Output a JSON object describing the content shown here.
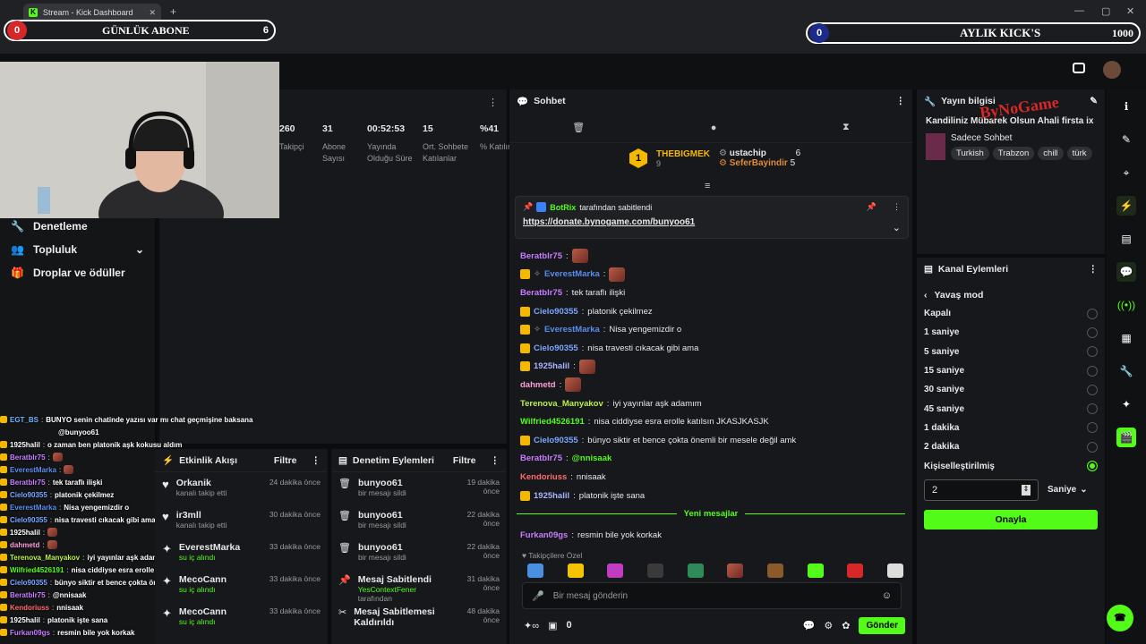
{
  "browser": {
    "tab_title": "Stream - Kick Dashboard",
    "url": "dashboard.kick.com/stream"
  },
  "overlay": {
    "daily_left_value": "0",
    "daily_label": "GÜNLÜK ABONE",
    "daily_right_value": "6",
    "monthly_left_value": "0",
    "monthly_label": "AYLIK KICK'S",
    "monthly_right_value": "1000"
  },
  "nav": {
    "items": [
      {
        "label": "Denetleme",
        "icon": "wrench-icon"
      },
      {
        "label": "Topluluk",
        "icon": "community-icon"
      },
      {
        "label": "Droplar ve ödüller",
        "icon": "gift-icon"
      }
    ]
  },
  "stats": [
    {
      "value": "260",
      "label": "Takipçi"
    },
    {
      "value": "31",
      "label": "Abone Sayısı"
    },
    {
      "value": "00:52:53",
      "label": "Yayında Olduğu Süre"
    },
    {
      "value": "15",
      "label": "Ort. Sohbete Katılanlar"
    },
    {
      "value": "%41",
      "label": "% Katılım"
    }
  ],
  "activity": {
    "title": "Etkinlik Akışı",
    "filter": "Filtre",
    "items": [
      {
        "name": "Orkanik",
        "sub": "kanalı takip etti",
        "time": "24 dakika önce",
        "icon": "heart-icon"
      },
      {
        "name": "ir3mll",
        "sub": "kanalı takip etti",
        "time": "30 dakika önce",
        "icon": "heart-icon"
      },
      {
        "name": "EverestMarka",
        "sub": "su iç alındı",
        "time": "33 dakika önce",
        "icon": "points-icon"
      },
      {
        "name": "MecoCann",
        "sub": "su iç alındı",
        "time": "33 dakika önce",
        "icon": "points-icon"
      },
      {
        "name": "MecoCann",
        "sub": "su iç alındı",
        "time": "33 dakika önce",
        "icon": "points-icon"
      }
    ]
  },
  "moderation": {
    "title": "Denetim Eylemleri",
    "filter": "Filtre",
    "items": [
      {
        "name": "bunyoo61",
        "sub": "bir mesajı sildi",
        "time": "19 dakika önce"
      },
      {
        "name": "bunyoo61",
        "sub": "bir mesajı sildi",
        "time": "22 dakika önce"
      },
      {
        "name": "bunyoo61",
        "sub": "bir mesajı sildi",
        "time": "22 dakika önce"
      },
      {
        "name": "Mesaj Sabitlendi",
        "sub": "YesContextFener",
        "sub2": "tarafından",
        "time": "31 dakika önce"
      },
      {
        "name": "Mesaj Sabitlemesi Kaldırıldı",
        "sub": "",
        "time": "48 dakika önce"
      }
    ]
  },
  "chat": {
    "title": "Sohbet",
    "leaderboard": {
      "first_name": "THEBIGMEK",
      "first_count": "9",
      "first_rank": "1",
      "second_name": "ustachip",
      "second_count": "6",
      "third_name": "SeferBayindir",
      "third_count": "5"
    },
    "pinned": {
      "by_user": "BotRix",
      "by_text": "tarafından sabitlendi",
      "link": "https://donate.bynogame.com/bunyoo61"
    },
    "messages": [
      {
        "user": "Beratblr75",
        "color": "#c77dff",
        "text": "",
        "emote": true
      },
      {
        "user": "EverestMarka",
        "color": "#5b8def",
        "text": "",
        "emote": true
      },
      {
        "user": "Beratblr75",
        "color": "#c77dff",
        "text": "tek taraflı ilişki"
      },
      {
        "user": "Cielo90355",
        "color": "#7aa7ff",
        "text": "platonik çekilmez"
      },
      {
        "user": "EverestMarka",
        "color": "#5b8def",
        "text": "Nisa yengemizdir o"
      },
      {
        "user": "Cielo90355",
        "color": "#7aa7ff",
        "text": "nisa travesti cıkacak gibi ama"
      },
      {
        "user": "1925halil",
        "color": "#a9b4ff",
        "text": "",
        "emote": true
      },
      {
        "user": "dahmetd",
        "color": "#ff9ed8",
        "text": "",
        "emote": true
      },
      {
        "user": "Terenova_Manyakov",
        "color": "#b8f04a",
        "text": "iyi yayınlar aşk adamım"
      },
      {
        "user": "Wilfried4526191",
        "color": "#53fc18",
        "text": "nisa ciddiyse esra erolle katılsın JKASJKASJK"
      },
      {
        "user": "Cielo90355",
        "color": "#7aa7ff",
        "text": "bünyo siktir et bence çokta önemli bir mesele değil amk"
      },
      {
        "user": "Beratblr75",
        "color": "#c77dff",
        "text": "@nnisaak",
        "bold_text": true
      },
      {
        "user": "Kendoriuss",
        "color": "#ff6b6b",
        "text": "nnisaak"
      },
      {
        "user": "1925halil",
        "color": "#a9b4ff",
        "text": "platonik işte sana"
      }
    ],
    "new_messages": "Yeni mesajlar",
    "last_message": {
      "user": "Furkan09gs",
      "color": "#c77dff",
      "text": "resmin bile yok korkak"
    },
    "followers_only": "Takipçilere Özel",
    "input_placeholder": "Bir mesaj gönderin",
    "points": "0",
    "send": "Gönder"
  },
  "stream_info": {
    "title": "Yayın bilgisi",
    "stream_title": "Kandiliniz Mübarek Olsun Ahali firsta ix",
    "category": "Sadece Sohbet",
    "tags": [
      "Turkish",
      "Trabzon",
      "chill",
      "türk"
    ]
  },
  "channel_actions": {
    "title": "Kanal Eylemleri",
    "back_label": "Yavaş mod",
    "options": [
      {
        "label": "Kapalı",
        "selected": false
      },
      {
        "label": "1 saniye",
        "selected": false
      },
      {
        "label": "5 saniye",
        "selected": false
      },
      {
        "label": "15 saniye",
        "selected": false
      },
      {
        "label": "30 saniye",
        "selected": false
      },
      {
        "label": "45 saniye",
        "selected": false
      },
      {
        "label": "1 dakika",
        "selected": false
      },
      {
        "label": "2 dakika",
        "selected": false
      },
      {
        "label": "Kişiselleştirilmiş",
        "selected": true
      }
    ],
    "custom_value": "2",
    "unit": "Saniye",
    "confirm": "Onayla"
  },
  "overlay_chat": [
    {
      "user": "EGT_BS",
      "color": "#6fb3ff",
      "text": "BUNYO senin chatinde yazısı var mı chat geçmişine baksana"
    },
    {
      "user": "",
      "color": "#fff",
      "text": "@bunyoo61"
    },
    {
      "user": "1925halil",
      "color": "#fff",
      "text": "o zaman ben platonik aşk kokusu aldım"
    },
    {
      "user": "Beratblr75",
      "color": "#c77dff",
      "text": ""
    },
    {
      "user": "EverestMarka",
      "color": "#5b8def",
      "text": ""
    },
    {
      "user": "Beratblr75",
      "color": "#c77dff",
      "text": "tek taraflı ilişki"
    },
    {
      "user": "Cielo90355",
      "color": "#7aa7ff",
      "text": "platonik çekilmez"
    },
    {
      "user": "EverestMarka",
      "color": "#5b8def",
      "text": "Nisa yengemizdir o"
    },
    {
      "user": "Cielo90355",
      "color": "#7aa7ff",
      "text": "nisa travesti cıkacak gibi ama"
    },
    {
      "user": "1925halil",
      "color": "#fff",
      "text": ""
    },
    {
      "user": "dahmetd",
      "color": "#ff9ed8",
      "text": ""
    },
    {
      "user": "Terenova_Manyakov",
      "color": "#b8f04a",
      "text": "iyi yayınlar aşk adamım"
    },
    {
      "user": "Wilfried4526191",
      "color": "#53fc18",
      "text": "nisa ciddiyse esra erolle katılsın JKASJKASJK"
    },
    {
      "user": "Cielo90355",
      "color": "#7aa7ff",
      "text": "bünyo siktir et bence çokta önemli bir mesele değil amk"
    },
    {
      "user": "Beratblr75",
      "color": "#c77dff",
      "text": "@nnisaak"
    },
    {
      "user": "Kendoriuss",
      "color": "#ff6b6b",
      "text": "nnisaak"
    },
    {
      "user": "1925halil",
      "color": "#fff",
      "text": "platonik işte sana"
    },
    {
      "user": "Furkan09gs",
      "color": "#c77dff",
      "text": "resmin bile yok korkak"
    }
  ],
  "colors": {
    "accent": "#53fc18",
    "panel": "#17181b",
    "background": "#0b0c0e"
  }
}
